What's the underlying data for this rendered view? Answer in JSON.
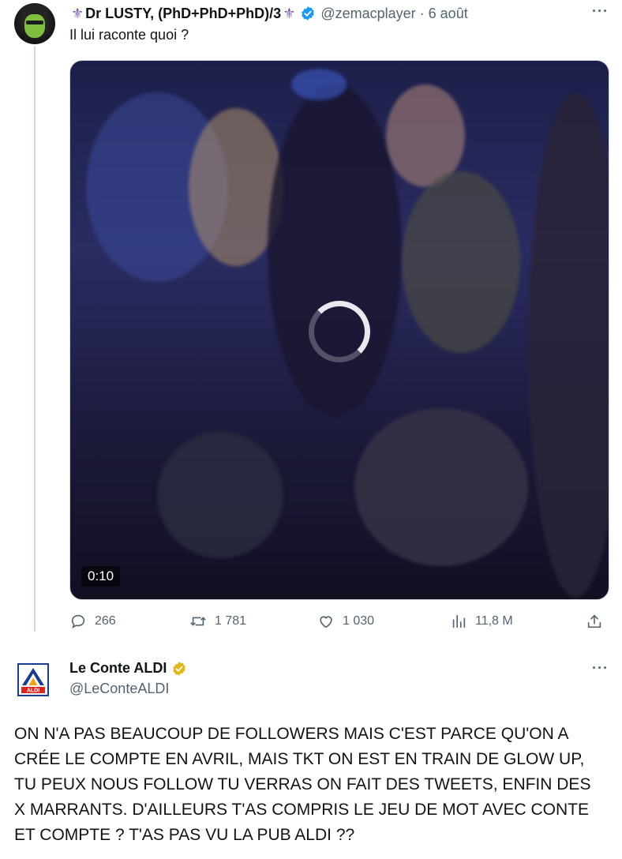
{
  "tweet1": {
    "display_name": "Dr LUSTY, (PhD+PhD+PhD)/3",
    "handle": "@zemacplayer",
    "separator": "·",
    "date": "6 août",
    "text": "Il lui raconte quoi ?",
    "video_duration": "0:10",
    "stats": {
      "replies": "266",
      "reposts": "1 781",
      "likes": "1 030",
      "views": "11,8 M"
    }
  },
  "tweet2": {
    "display_name": "Le Conte ALDI",
    "handle": "@LeConteALDI",
    "text_lines": [
      "ON N'A PAS BEAUCOUP DE FOLLOWERS MAIS C'EST PARCE QU'ON A",
      "CRÉE LE COMPTE EN AVRIL, MAIS TKT ON EST EN TRAIN DE GLOW UP,",
      "TU PEUX NOUS FOLLOW TU VERRAS ON FAIT DES TWEETS, ENFIN DES",
      "X MARRANTS. D'AILLEURS T'AS COMPRIS LE JEU DE MOT AVEC CONTE",
      "ET COMPTE ? T'AS PAS VU LA PUB ALDI ??"
    ]
  },
  "more_label": "···",
  "fleur_glyph": "⚜",
  "avatar2_logo_text": "ALDI",
  "colors": {
    "verified_blue": "#1d9bf0",
    "verified_gold": "#e2b719",
    "secondary_text": "#536471",
    "aldi_blue": "#1a3c8c"
  }
}
